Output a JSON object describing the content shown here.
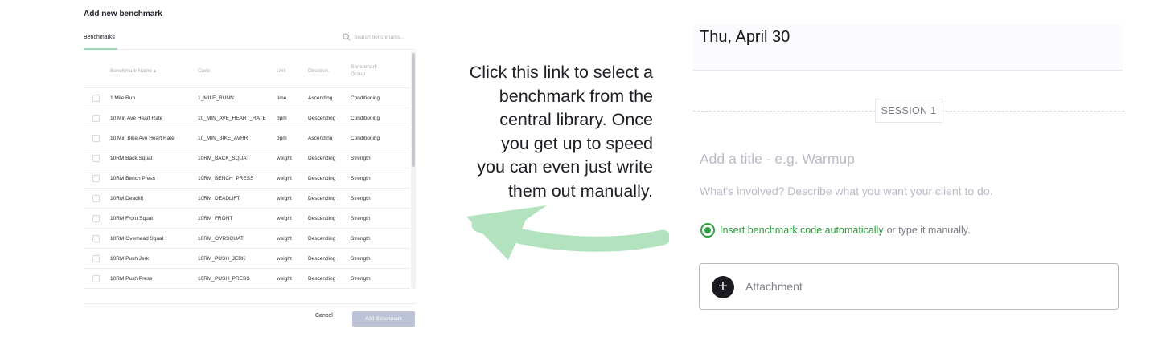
{
  "modal": {
    "title": "Add new benchmark",
    "tab_label": "Benchmarks",
    "search_placeholder": "Search benchmarks...",
    "columns": {
      "name": "Benchmark Name ▴",
      "code": "Code",
      "unit": "Unit",
      "direction": "Direction",
      "group": "Benchmark Group"
    },
    "rows": [
      {
        "name": "1 Mile Run",
        "code": "1_MILE_RUNN",
        "unit": "time",
        "direction": "Ascending",
        "group": "Conditioning"
      },
      {
        "name": "10 Min Ave Heart Rate",
        "code": "10_MIN_AVE_HEART_RATE",
        "unit": "bpm",
        "direction": "Descending",
        "group": "Conditioning"
      },
      {
        "name": "10 Min Bike Ave Heart Rate",
        "code": "10_MIN_BIKE_AVHR",
        "unit": "bpm",
        "direction": "Ascending",
        "group": "Conditioning"
      },
      {
        "name": "10RM Back Squat",
        "code": "10RM_BACK_SQUAT",
        "unit": "weight",
        "direction": "Descending",
        "group": "Strength"
      },
      {
        "name": "10RM Bench Press",
        "code": "10RM_BENCH_PRESS",
        "unit": "weight",
        "direction": "Descending",
        "group": "Strength"
      },
      {
        "name": "10RM Deadlift",
        "code": "10RM_DEADLIFT",
        "unit": "weight",
        "direction": "Descending",
        "group": "Strength"
      },
      {
        "name": "10RM Front Squat",
        "code": "10RM_FRONT",
        "unit": "weight",
        "direction": "Descending",
        "group": "Strength"
      },
      {
        "name": "10RM Overhead Squat",
        "code": "10RM_OVRSQUAT",
        "unit": "weight",
        "direction": "Descending",
        "group": "Strength"
      },
      {
        "name": "10RM Push Jerk",
        "code": "10RM_PUSH_JERK",
        "unit": "weight",
        "direction": "Descending",
        "group": "Strength"
      },
      {
        "name": "10RM Push Press",
        "code": "10RM_PUSH_PRESS",
        "unit": "weight",
        "direction": "Descending",
        "group": "Strength"
      }
    ],
    "cancel_label": "Cancel",
    "add_label": "Add Benchmark"
  },
  "annotation": {
    "lines": [
      "Click this link to select a",
      "benchmark from the",
      "central library. Once",
      "you get up to speed",
      "you can even just write",
      "them out manually."
    ],
    "arrow_color": "#b3e2bf"
  },
  "session": {
    "date": "Thu, April 30",
    "chip_label": "SESSION 1",
    "title_placeholder": "Add a title - e.g. Warmup",
    "description_placeholder": "What's involved? Describe what you want your client to do.",
    "benchmark_link": "Insert benchmark code automatically",
    "benchmark_rest": "or type it manually.",
    "attachment_label": "Attachment",
    "accent_color": "#2e9a40"
  }
}
